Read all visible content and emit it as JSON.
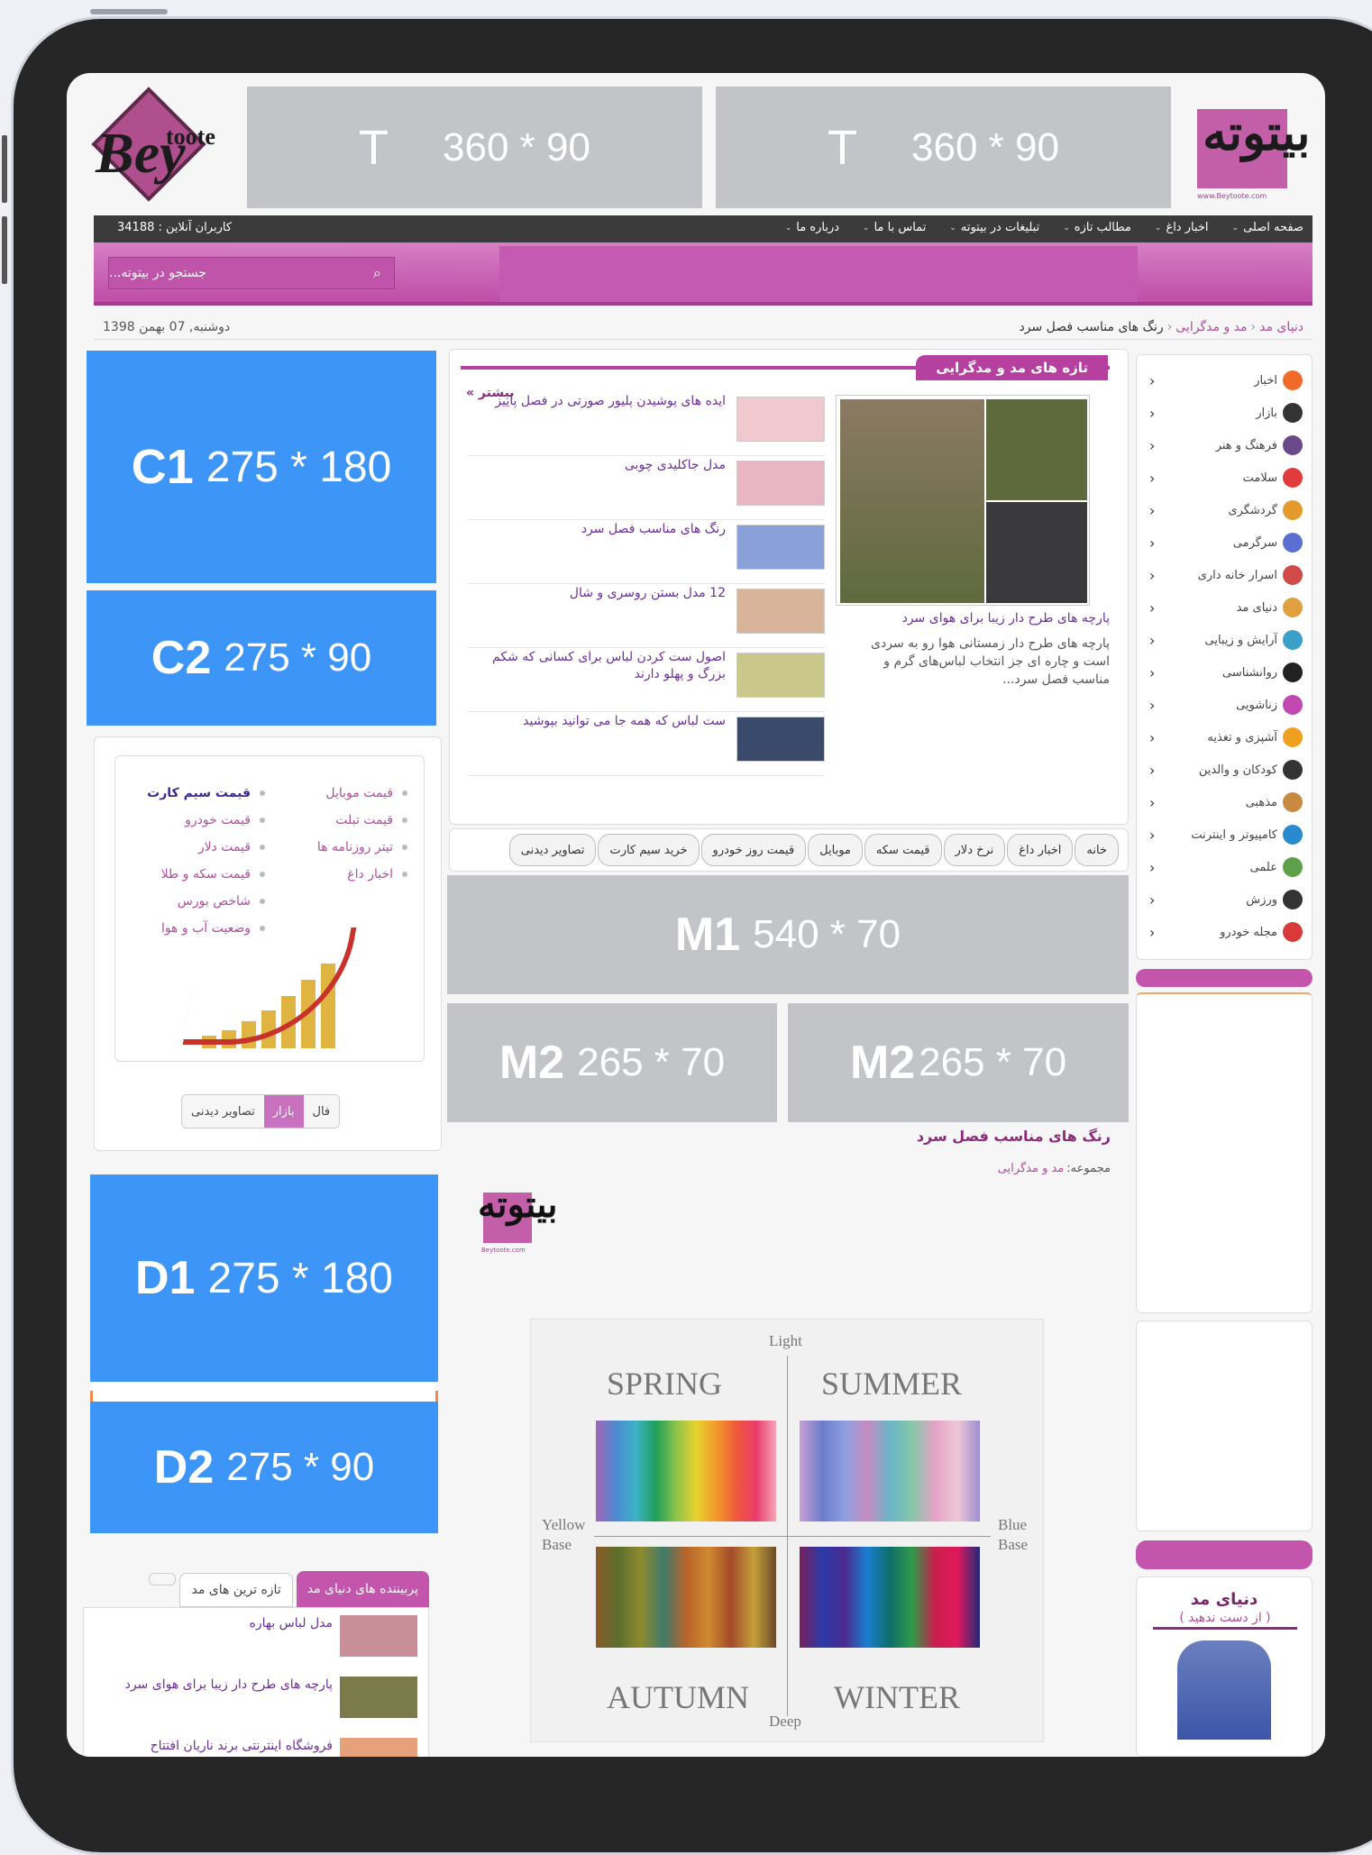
{
  "header": {
    "logo_left": {
      "main": "Bey",
      "sub": "toote"
    },
    "ad_top_1": {
      "letter": "T",
      "size": "360 * 90"
    },
    "ad_top_2": {
      "letter": "T",
      "size": "360 * 90"
    },
    "logo_right_url": "www.Beytoote.com"
  },
  "menu": {
    "items": [
      "صفحه اصلی",
      "اخبار داغ",
      "مطالب تازه",
      "تبلیغات در بیتوته",
      "تماس با ما",
      "درباره ما"
    ],
    "online_users": "کاربران آنلاین : 34188",
    "search_placeholder": "جستجو در بیتوته..."
  },
  "breadcrumb": {
    "items": [
      "دنیای مد",
      "مد و مدگرایی",
      "رنگ های مناسب فصل سرد"
    ],
    "date": "دوشنبه, 07 بهمن 1398"
  },
  "categories": [
    "اخبار",
    "بازار",
    "فرهنگ و هنر",
    "سلامت",
    "گردشگری",
    "سرگرمی",
    "اسرار خانه داری",
    "دنیای مد",
    "آرایش و زیبایی",
    "روانشناسی",
    "زناشویی",
    "آشپزی و تغذیه",
    "کودکان و والدین",
    "مذهبی",
    "کامپیوتر و اینترنت",
    "علمی",
    "ورزش",
    "مجله خودرو"
  ],
  "fresh": {
    "title": "تازه های مد و مدگرایی",
    "more": "بیشتر »",
    "featured_title": "پارچه های طرح دار زیبا برای هوای سرد",
    "featured_text": "پارچه های طرح دار زمستانی هوا رو به سردی است و چاره ای جز انتخاب لباس‌های گرم و مناسب فصل سرد...",
    "items": [
      "ایده های پوشیدن پلیور صورتی در فصل پاییز",
      "مدل جاکلیدی چوبی",
      "رنگ های مناسب فصل سرد",
      "12 مدل بستن روسری و شال",
      "اصول ست کردن لباس برای کسانی که شکم بزرگ و پهلو دارند",
      "ست لباس که همه جا می توانید بپوشید"
    ]
  },
  "tabs": [
    "خانه",
    "اخبار داغ",
    "نرخ دلار",
    "قیمت سکه",
    "موبایل",
    "قیمت روز خودرو",
    "خرید سیم کارت",
    "تصاویر دیدنی"
  ],
  "ads_mid": {
    "m1": {
      "code": "M1",
      "size": "540 * 70"
    },
    "m2a": {
      "code": "M2",
      "size": "265 * 70"
    },
    "m2b": {
      "code": "M2",
      "size": "265 * 70"
    }
  },
  "article": {
    "title": "رنگ های مناسب فصل سرد",
    "category_label": "مجموعه:",
    "category": "مد و مدگرایی",
    "logo_url": "Beytoote.com",
    "image": {
      "light": "Light",
      "deep": "Deep",
      "yellow": "Yellow",
      "yellow2": "Base",
      "blue": "Blue",
      "blue2": "Base",
      "spring": "SPRING",
      "summer": "SUMMER",
      "autumn": "AUTUMN",
      "winter": "WINTER"
    }
  },
  "left": {
    "c1": {
      "code": "C1",
      "size": "275 * 180"
    },
    "c2": {
      "code": "C2",
      "size": "275 * 90"
    },
    "d1": {
      "code": "D1",
      "size": "275 * 180"
    },
    "d2": {
      "code": "D2",
      "size": "275 * 90"
    },
    "links_right": [
      "قیمت موبایل",
      "قیمت تبلت",
      "تیتر روزنامه ها",
      "اخبار داغ"
    ],
    "links_left": [
      "قیمت سیم کارت",
      "قیمت خودرو",
      "قیمت دلار",
      "قیمت سکه و طلا",
      "شاخص بورس",
      "وضعیت آب و هوا"
    ],
    "tabs": [
      "فال",
      "بازار",
      "تصاویر دیدنی"
    ],
    "bottom_tabs": [
      "پربیننده های دنیای مد",
      "تازه ترین های مد"
    ],
    "bottom_items": [
      "مدل لباس بهاره",
      "پارچه های طرح دار زیبا برای هوای سرد",
      "فروشگاه اینترنتی برند ناریان افتتاح"
    ]
  },
  "right_box": {
    "title": "دنیای مد",
    "subtitle": "( از دست ندهید )"
  },
  "colors": {
    "accent": "#b5409f",
    "link": "#6b2f9a",
    "ad_blue": "#3e95f8",
    "ad_gray": "#c3c4c8"
  }
}
